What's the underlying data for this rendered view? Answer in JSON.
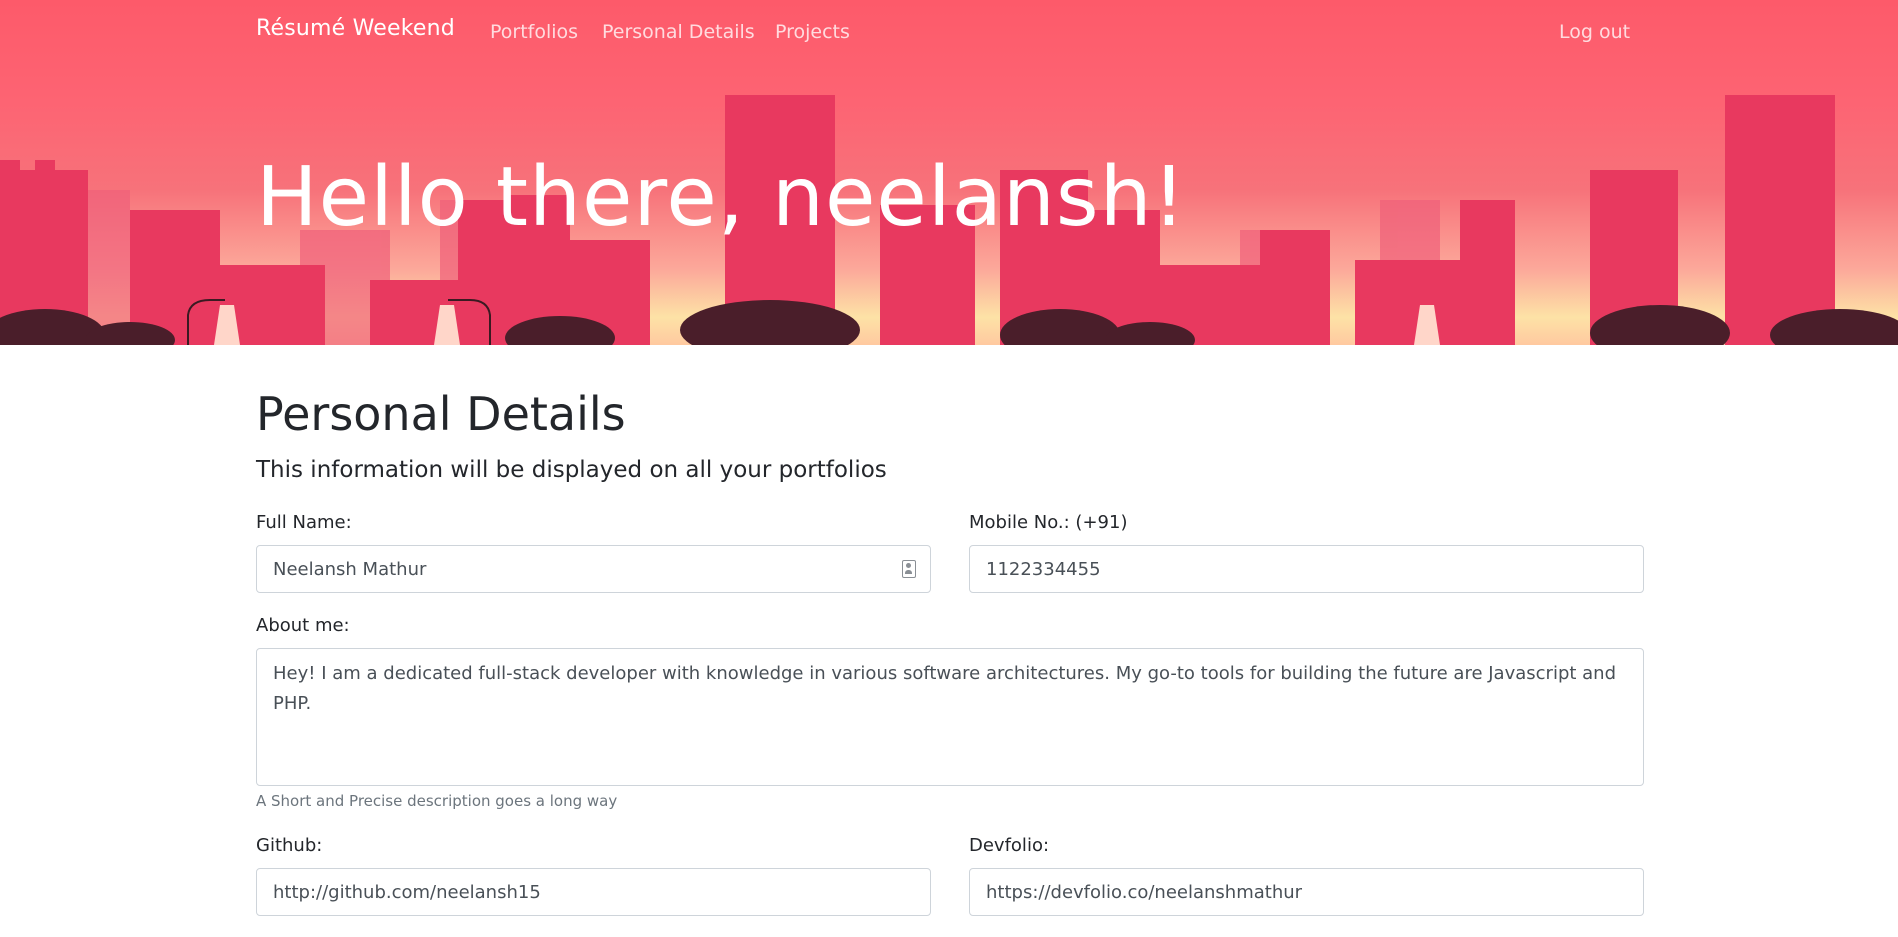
{
  "nav": {
    "brand": "Résumé Weekend",
    "links": [
      "Portfolios",
      "Personal Details",
      "Projects"
    ],
    "logout": "Log out"
  },
  "hero": {
    "greeting": "Hello there, neelansh!"
  },
  "section": {
    "title": "Personal Details",
    "subtitle": "This information will be displayed on all your portfolios"
  },
  "form": {
    "full_name": {
      "label": "Full Name:",
      "value": "Neelansh Mathur"
    },
    "mobile": {
      "label": "Mobile No.: (+91)",
      "value": "1122334455"
    },
    "about": {
      "label": "About me:",
      "value": "Hey! I am a dedicated full-stack developer with knowledge in various software architectures. My go-to tools for building the future are Javascript and PHP.",
      "help": "A Short and Precise description goes a long way"
    },
    "github": {
      "label": "Github:",
      "value": "http://github.com/neelansh15"
    },
    "devfolio": {
      "label": "Devfolio:",
      "value": "https://devfolio.co/neelanshmathur"
    }
  },
  "colors": {
    "hero_top": "#fd5a6a",
    "hero_horizon": "#fde2a6",
    "building": "#e8395f"
  }
}
